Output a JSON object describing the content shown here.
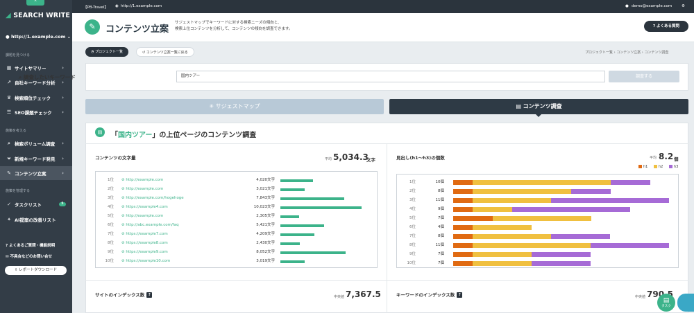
{
  "sidebar": {
    "brand": "SEARCH WRITE",
    "site": "http://1.example.com",
    "sections": [
      "課題を見つける",
      "施策を考える",
      "施策を管理する"
    ],
    "items": [
      {
        "label": "サイトサマリー",
        "icon": "grid-icon"
      },
      {
        "label": "自社キーワード分析",
        "icon": "trend-icon"
      },
      {
        "label": "検索順位チェック",
        "icon": "crown-icon"
      },
      {
        "label": "SEO課題チェック",
        "icon": "checklist-icon"
      },
      {
        "label": "検索ボリューム調査",
        "icon": "search-icon"
      },
      {
        "label": "新規キーワード発見",
        "icon": "funnel-icon"
      },
      {
        "label": "コンテンツ立案",
        "icon": "edit-icon"
      },
      {
        "label": "タスクリスト",
        "icon": "check-icon",
        "badge": "5"
      },
      {
        "label": "AI提案の改善リスト",
        "icon": "lightbulb-icon"
      }
    ],
    "footer": [
      "よくあるご質問・機能説明",
      "不具合などのお問い合せ"
    ],
    "download": "レポートダウンロード"
  },
  "topbar": {
    "project": "【PB-Travel】",
    "url": "http://1.example.com",
    "user": "demo@example.com"
  },
  "header": {
    "title": "コンテンツ立案",
    "desc1": "サジェストマップでキーワードに対する検索ニーズの傾向と、",
    "desc2": "検索上位コンテンツを分析して、コンテンツの傾向を調査できます。",
    "faq": "よくある質問"
  },
  "pills": {
    "list": "プロジェクト一覧",
    "back": "コンテンツ立案一覧に戻る"
  },
  "breadcrumb": {
    "a": "プロジェクト一覧",
    "b": "コンテンツ立案",
    "c": "コンテンツ調査"
  },
  "search": {
    "label": "調査したいキーワード",
    "value": "国内ツアー",
    "button": "調査する"
  },
  "tabs": {
    "suggest": "サジェストマップ",
    "content": "コンテンツ調査"
  },
  "section": {
    "prefix": "「",
    "keyword": "国内ツアー",
    "suffix": "」の上位ページのコンテンツ調査"
  },
  "wordcount": {
    "title": "コンテンツの文字量",
    "avg_label": "平均",
    "avg": "5,034.3",
    "unit": "文字",
    "max": 10023,
    "rows": [
      {
        "rank": "1位",
        "url": "http://example.com",
        "count": "4,020文字",
        "value": 4020
      },
      {
        "rank": "2位",
        "url": "http://example.com",
        "count": "3,021文字",
        "value": 3021
      },
      {
        "rank": "3位",
        "url": "http://example.com/hogehoge",
        "count": "7,843文字",
        "value": 7843
      },
      {
        "rank": "4位",
        "url": "https://example4.com",
        "count": "10,023文字",
        "value": 10023
      },
      {
        "rank": "5位",
        "url": "http://example.com",
        "count": "2,305文字",
        "value": 2305
      },
      {
        "rank": "6位",
        "url": "http://abc.example.com/faq",
        "count": "5,421文字",
        "value": 5421
      },
      {
        "rank": "7位",
        "url": "https://example7.com",
        "count": "4,209文字",
        "value": 4209
      },
      {
        "rank": "8位",
        "url": "https://example8.com",
        "count": "2,430文字",
        "value": 2430
      },
      {
        "rank": "9位",
        "url": "https://example9.com",
        "count": "8,052文字",
        "value": 8052
      },
      {
        "rank": "10位",
        "url": "https://example10.com",
        "count": "3,019文字",
        "value": 3019
      }
    ]
  },
  "headings": {
    "title": "見出し(h1〜h3)の個数",
    "avg_label": "平均",
    "avg": "8.2",
    "unit": "個",
    "legend": [
      {
        "name": "h1",
        "color": "#e06a12"
      },
      {
        "name": "h2",
        "color": "#f0c040"
      },
      {
        "name": "h3",
        "color": "#a66bd6"
      }
    ],
    "max": 11,
    "rows": [
      {
        "rank": "1位",
        "count": "10個",
        "h1": 1,
        "h2": 7,
        "h3": 2
      },
      {
        "rank": "2位",
        "count": "8個",
        "h1": 1,
        "h2": 5,
        "h3": 2
      },
      {
        "rank": "3位",
        "count": "11個",
        "h1": 1,
        "h2": 4,
        "h3": 6
      },
      {
        "rank": "4位",
        "count": "9個",
        "h1": 1,
        "h2": 2,
        "h3": 6
      },
      {
        "rank": "5位",
        "count": "7個",
        "h1": 2,
        "h2": 5,
        "h3": 0
      },
      {
        "rank": "6位",
        "count": "4個",
        "h1": 1,
        "h2": 3,
        "h3": 0
      },
      {
        "rank": "7位",
        "count": "8個",
        "h1": 1,
        "h2": 4,
        "h3": 3
      },
      {
        "rank": "8位",
        "count": "11個",
        "h1": 1,
        "h2": 6,
        "h3": 4
      },
      {
        "rank": "9位",
        "count": "7個",
        "h1": 1,
        "h2": 3,
        "h3": 3
      },
      {
        "rank": "10位",
        "count": "7個",
        "h1": 1,
        "h2": 3,
        "h3": 3
      }
    ]
  },
  "site_index": {
    "title": "サイトのインデックス数",
    "median_label": "中央値",
    "median": "7,367.5"
  },
  "kw_index": {
    "title": "キーワードのインデックス数",
    "median_label": "中央値",
    "median": "790.5"
  },
  "float": {
    "task": "タスク"
  }
}
